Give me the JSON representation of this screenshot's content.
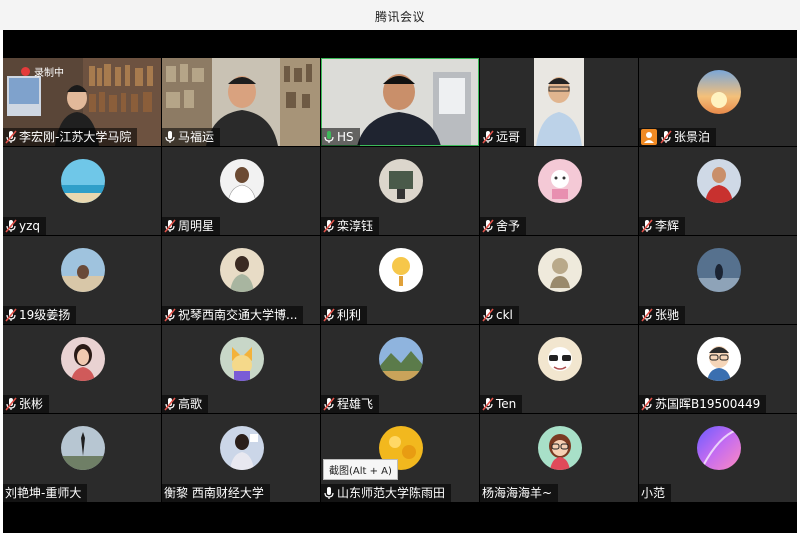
{
  "window": {
    "title": "腾讯会议"
  },
  "recording": {
    "label": "录制中"
  },
  "tooltip": {
    "text": "截图(Alt + A)"
  },
  "colors": {
    "active_speaker": "#3dbb5a",
    "mic_muted": "#e0524a",
    "host_badge": "#f08a24"
  },
  "participants": [
    {
      "name": "李宏刚-江苏大学马院",
      "mic": "muted",
      "kind": "video"
    },
    {
      "name": "马福运",
      "mic": "on",
      "kind": "video"
    },
    {
      "name": "HS",
      "mic": "speaking",
      "kind": "video"
    },
    {
      "name": "远哥",
      "mic": "muted",
      "kind": "video"
    },
    {
      "name": "张景泊",
      "mic": "muted",
      "kind": "avatar",
      "host": true
    },
    {
      "name": "yzq",
      "mic": "muted",
      "kind": "avatar"
    },
    {
      "name": "周明星",
      "mic": "muted",
      "kind": "avatar"
    },
    {
      "name": "栾淳钰",
      "mic": "muted",
      "kind": "avatar"
    },
    {
      "name": "舍予",
      "mic": "muted",
      "kind": "avatar"
    },
    {
      "name": "李辉",
      "mic": "muted",
      "kind": "avatar"
    },
    {
      "name": "19级姜扬",
      "mic": "muted",
      "kind": "avatar"
    },
    {
      "name": "祝琴西南交通大学博...",
      "mic": "muted",
      "kind": "avatar"
    },
    {
      "name": "利利",
      "mic": "muted",
      "kind": "avatar"
    },
    {
      "name": "ckl",
      "mic": "muted",
      "kind": "avatar"
    },
    {
      "name": "张驰",
      "mic": "muted",
      "kind": "avatar"
    },
    {
      "name": "张彬",
      "mic": "muted",
      "kind": "avatar"
    },
    {
      "name": "高歌",
      "mic": "muted",
      "kind": "avatar"
    },
    {
      "name": "程雄飞",
      "mic": "muted",
      "kind": "avatar"
    },
    {
      "name": "Ten",
      "mic": "muted",
      "kind": "avatar"
    },
    {
      "name": "苏国晖B19500449",
      "mic": "muted",
      "kind": "avatar"
    },
    {
      "name": "刘艳坤-重师大",
      "mic": "none",
      "kind": "avatar"
    },
    {
      "name": "衡黎 西南财经大学",
      "mic": "none",
      "kind": "avatar"
    },
    {
      "name": "山东师范大学陈雨田",
      "mic": "on",
      "kind": "avatar"
    },
    {
      "name": "杨海海海羊~",
      "mic": "none",
      "kind": "avatar"
    },
    {
      "name": "小范",
      "mic": "none",
      "kind": "avatar"
    }
  ]
}
